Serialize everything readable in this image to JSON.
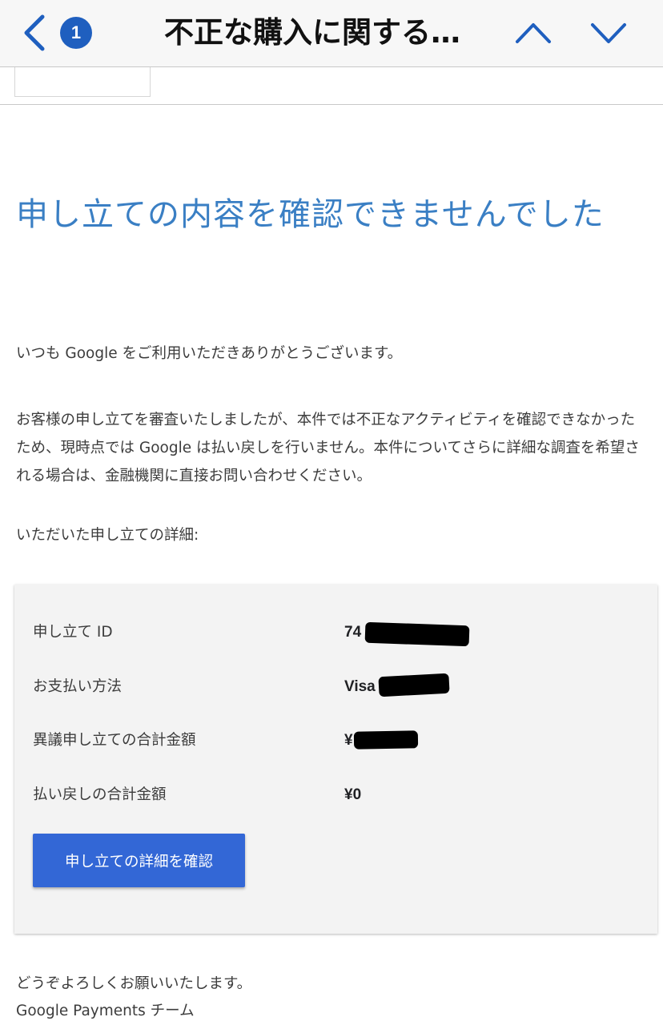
{
  "navbar": {
    "back_icon": "chevron-left-icon",
    "unread_count": "1",
    "title": "不正な購入に関する…",
    "prev_icon": "chevron-up-icon",
    "next_icon": "chevron-down-icon",
    "accent_color": "#1f5fbf"
  },
  "email": {
    "headline": "申し立ての内容を確認できませんでした",
    "greeting": "いつも Google をご利用いただきありがとうございます。",
    "body": "お客様の申し立てを審査いたしましたが、本件では不正なアクティビティを確認できなかったため、現時点では Google は払い戻しを行いません。本件についてさらに詳細な調査を希望される場合は、金融機関に直接お問い合わせください。",
    "details_intro": "いただいた申し立ての詳細:",
    "details": [
      {
        "label": "申し立て ID",
        "value": "74",
        "redacted": true
      },
      {
        "label": "お支払い方法",
        "value": "Visa",
        "redacted": true
      },
      {
        "label": "異議申し立ての合計金額",
        "value": "¥",
        "redacted": true
      },
      {
        "label": "払い戻しの合計金額",
        "value": "¥0",
        "redacted": false
      }
    ],
    "cta_label": "申し立ての詳細を確認",
    "closing_line": "どうぞよろしくお願いいたします。",
    "signature": "Google Payments チーム",
    "headline_color": "#3a7fc4",
    "button_color": "#3367d6"
  }
}
